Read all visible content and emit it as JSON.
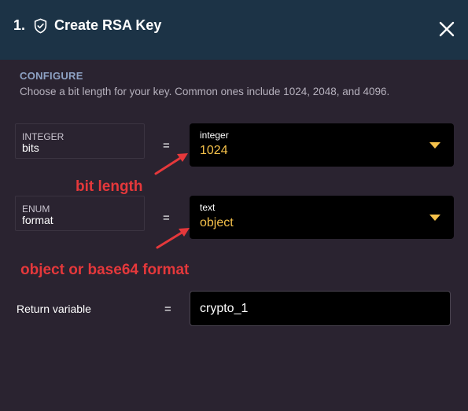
{
  "header": {
    "step": "1.",
    "title": "Create RSA Key",
    "icon": "shield-check-icon",
    "close_icon": "close-icon"
  },
  "configure": {
    "heading": "CONFIGURE",
    "description": "Choose a bit length for your key. Common ones include 1024, 2048, and 4096."
  },
  "params": [
    {
      "type": "INTEGER",
      "name": "bits",
      "equals": "=",
      "select_type": "integer",
      "select_value": "1024",
      "annotation": "bit length"
    },
    {
      "type": "ENUM",
      "name": "format",
      "equals": "=",
      "select_type": "text",
      "select_value": "object",
      "annotation": "object or base64 format"
    }
  ],
  "return_variable": {
    "label": "Return variable",
    "equals": "=",
    "value": "crypto_1"
  },
  "colors": {
    "header_bg": "#1c3346",
    "panel_bg": "#2a2330",
    "value_accent": "#f5c14a",
    "annotation_red": "#e5383b",
    "section_heading": "#8ea2c4"
  }
}
